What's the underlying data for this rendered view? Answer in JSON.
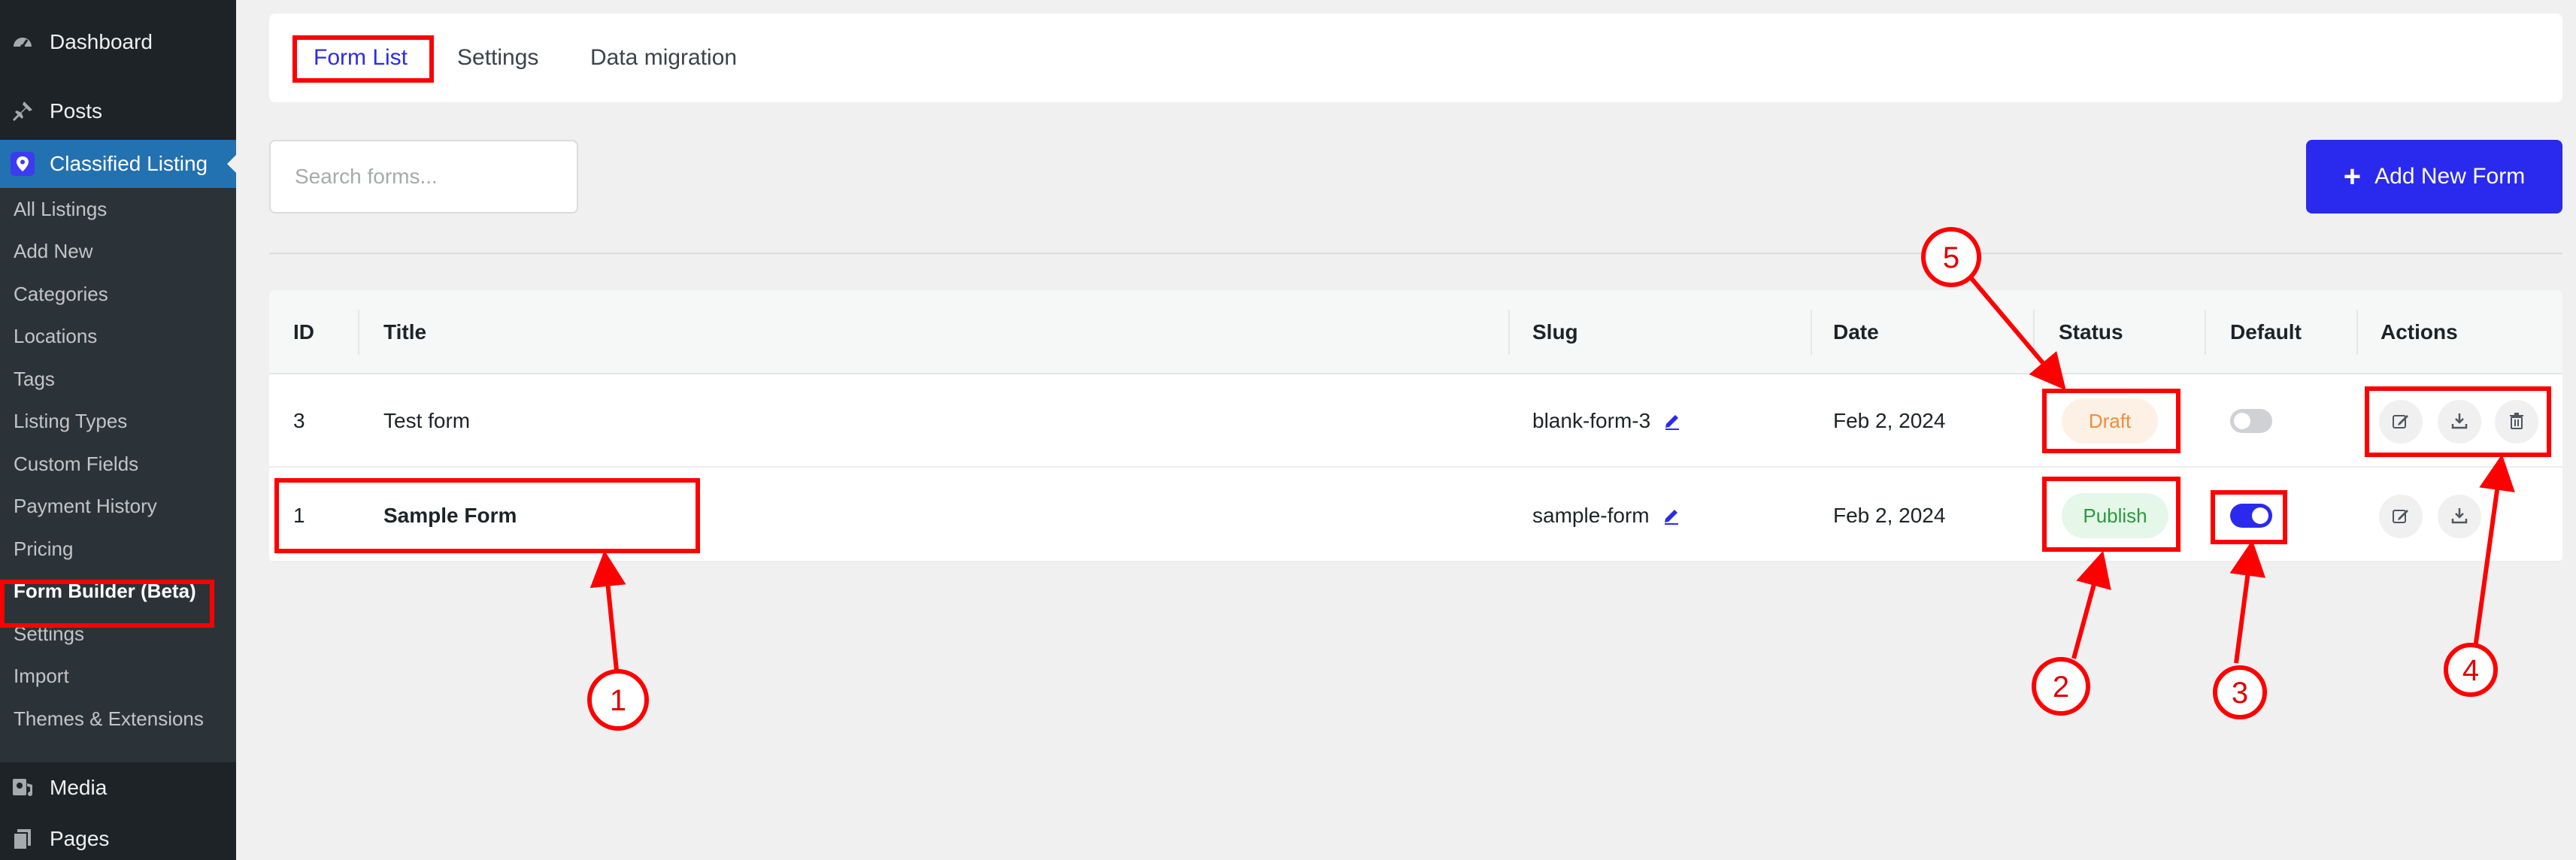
{
  "sidebar": {
    "top_items": [
      {
        "label": "Dashboard",
        "icon": "dashboard-icon"
      },
      {
        "label": "Posts",
        "icon": "pin-icon"
      },
      {
        "label": "Classified Listing",
        "icon": "map-pin-icon"
      }
    ],
    "submenu": [
      "All Listings",
      "Add New",
      "Categories",
      "Locations",
      "Tags",
      "Listing Types",
      "Custom Fields",
      "Payment History",
      "Pricing",
      "Form Builder (Beta)",
      "Settings",
      "Import",
      "Themes & Extensions"
    ],
    "bottom_items": [
      {
        "label": "Media",
        "icon": "media-icon"
      },
      {
        "label": "Pages",
        "icon": "page-icon"
      }
    ]
  },
  "tabs": [
    "Form List",
    "Settings",
    "Data migration"
  ],
  "search": {
    "placeholder": "Search forms..."
  },
  "add_button": {
    "label": "Add New Form"
  },
  "table": {
    "headers": {
      "id": "ID",
      "title": "Title",
      "slug": "Slug",
      "date": "Date",
      "status": "Status",
      "default": "Default",
      "actions": "Actions"
    },
    "rows": [
      {
        "id": "3",
        "title": "Test form",
        "slug": "blank-form-3",
        "date": "Feb 2, 2024",
        "status": "Draft",
        "default": false
      },
      {
        "id": "1",
        "title": "Sample Form",
        "slug": "sample-form",
        "date": "Feb 2, 2024",
        "status": "Publish",
        "default": true
      }
    ]
  },
  "annotations": [
    "1",
    "2",
    "3",
    "4",
    "5"
  ],
  "colors": {
    "accent": "#2a2aee",
    "sidebar_bg": "#1d2327",
    "sidebar_active": "#2271b1",
    "draft_bg": "#fdf1e5",
    "draft_text": "#f08c3a",
    "publish_bg": "#e5f7e9",
    "publish_text": "#2a9a3c",
    "annotation": "#ff0000"
  }
}
